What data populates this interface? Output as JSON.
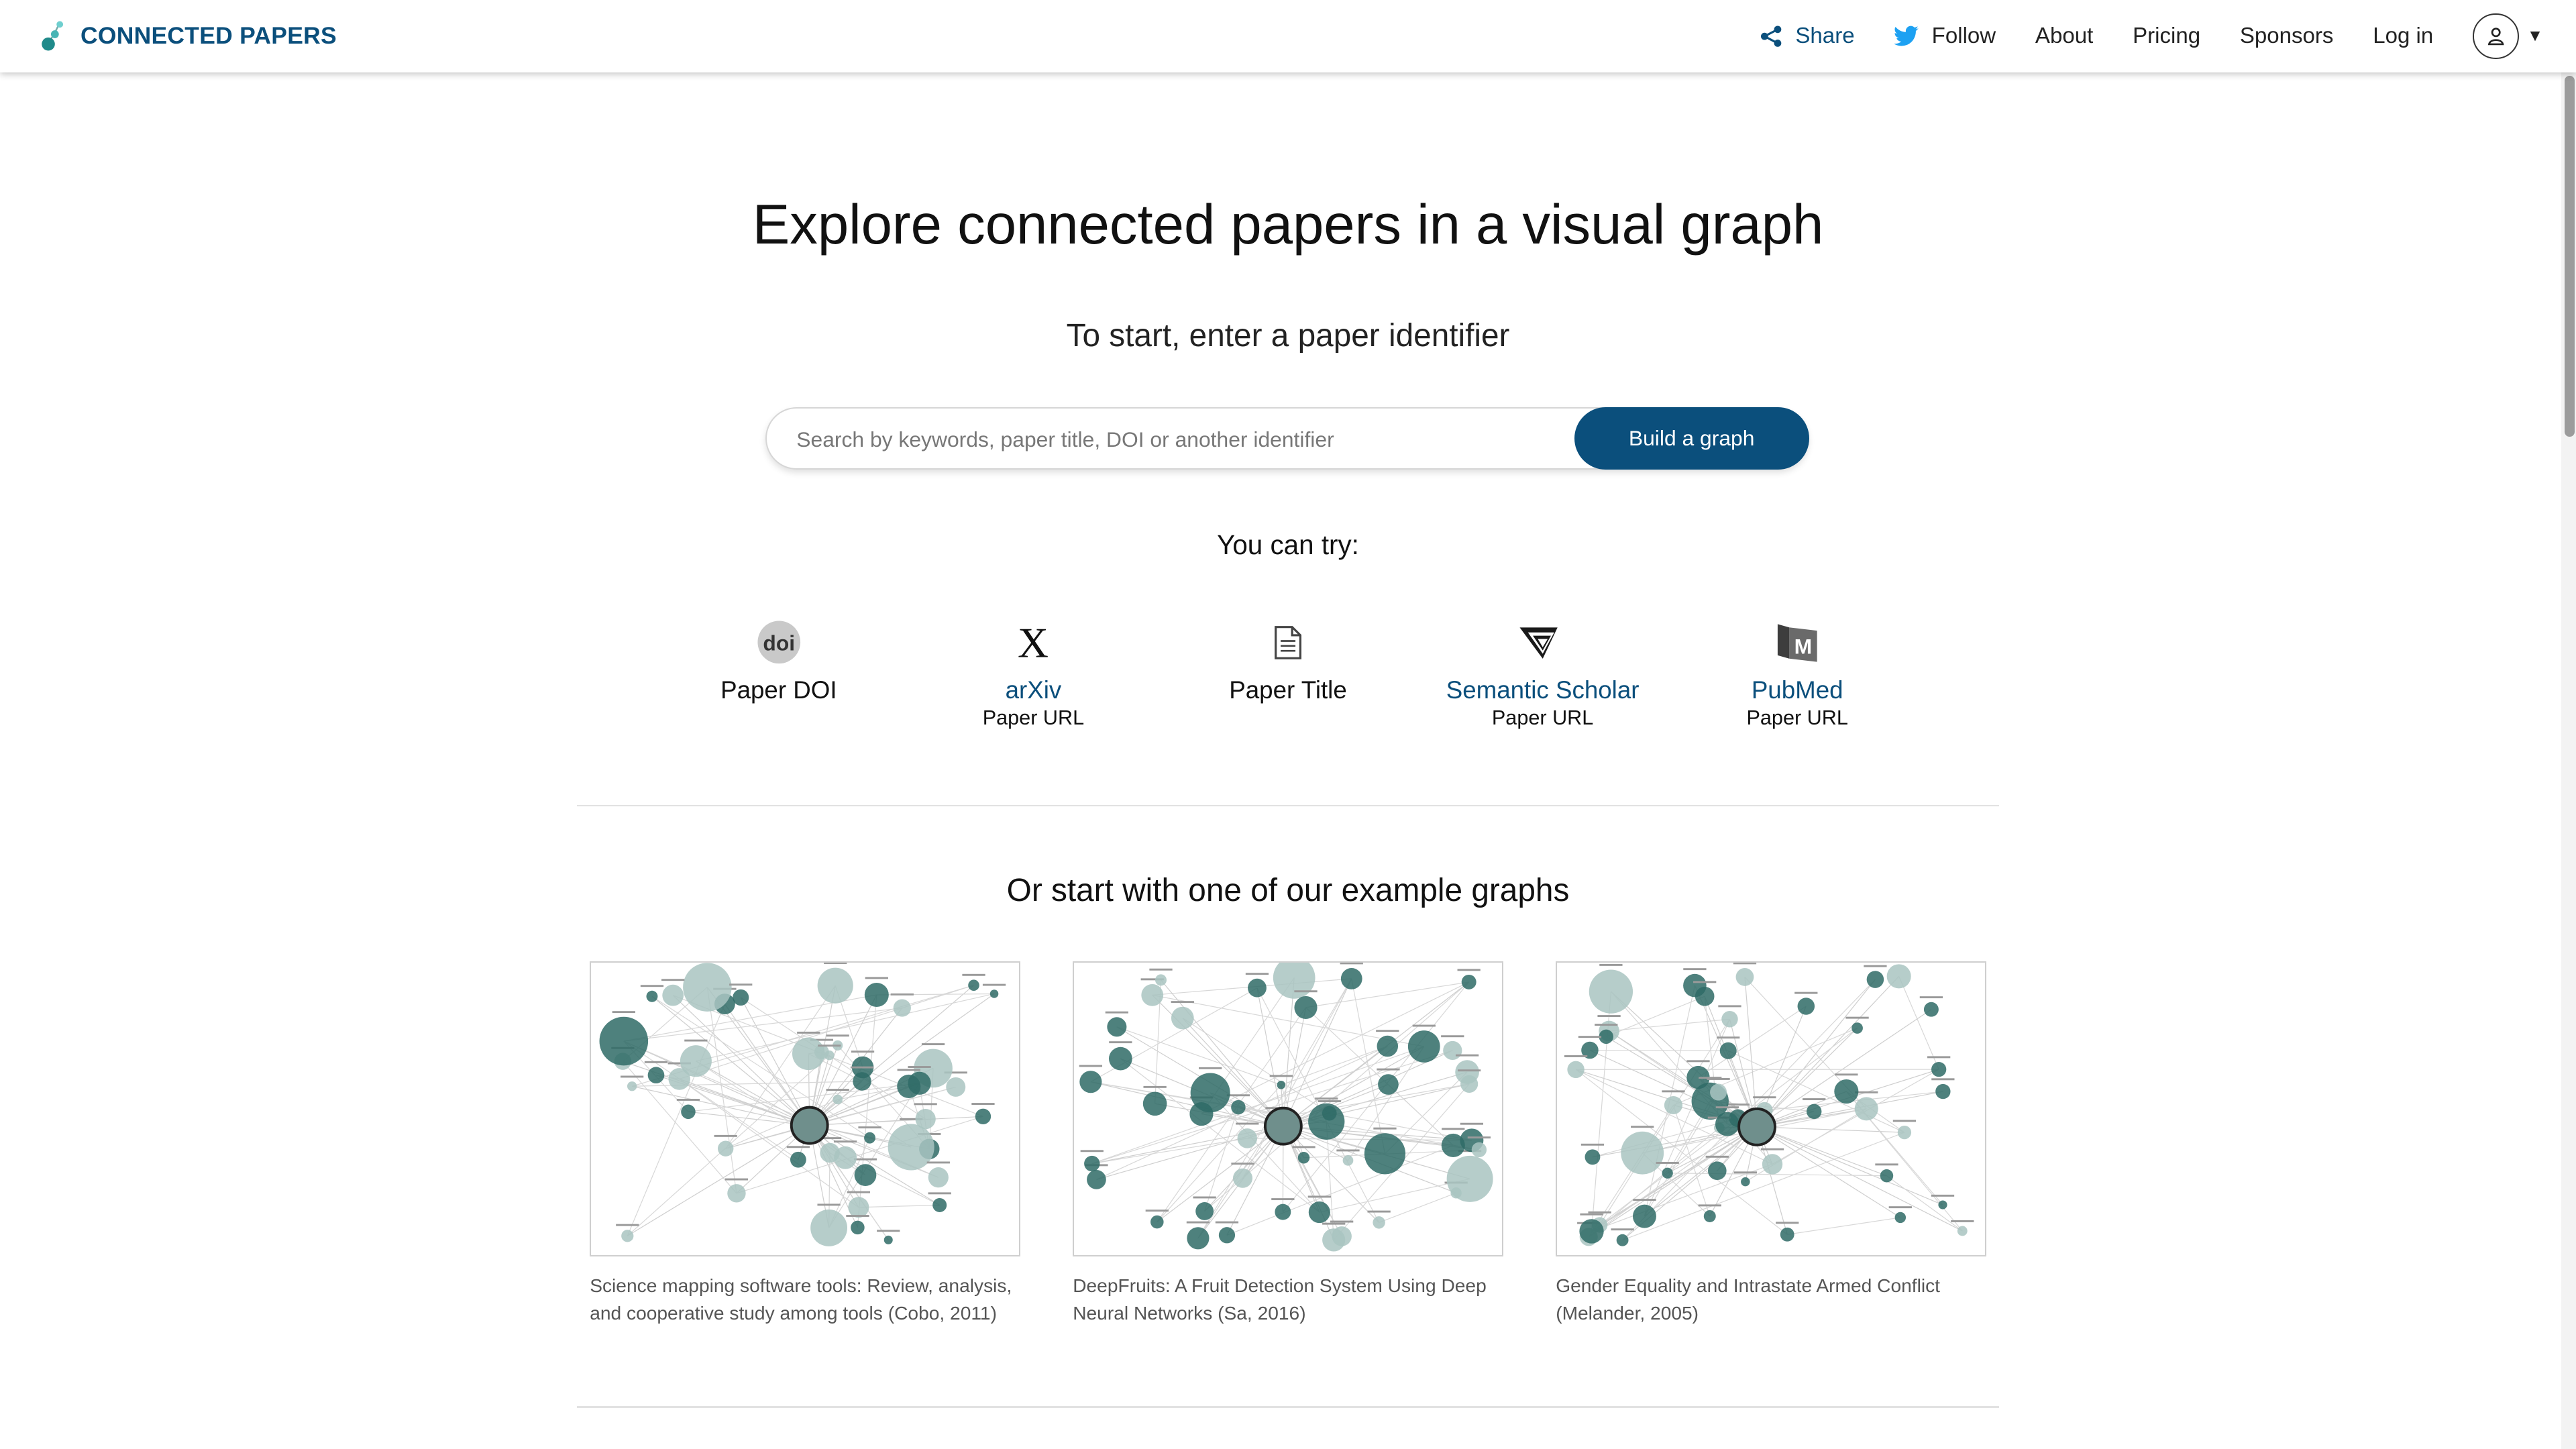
{
  "brand": {
    "name": "CONNECTED PAPERS"
  },
  "nav": {
    "share": "Share",
    "follow": "Follow",
    "about": "About",
    "pricing": "Pricing",
    "sponsors": "Sponsors",
    "login": "Log in"
  },
  "hero": {
    "title": "Explore connected papers in a visual graph",
    "subtitle": "To start, enter a paper identifier"
  },
  "search": {
    "placeholder": "Search by keywords, paper title, DOI or another identifier",
    "value": "",
    "button": "Build a graph"
  },
  "try": {
    "heading": "You can try:",
    "options": [
      {
        "label": "Paper DOI",
        "sub": "",
        "icon": "doi-icon"
      },
      {
        "label": "arXiv",
        "sub": "Paper URL",
        "icon": "arxiv-icon"
      },
      {
        "label": "Paper Title",
        "sub": "",
        "icon": "document-icon"
      },
      {
        "label": "Semantic Scholar",
        "sub": "Paper URL",
        "icon": "semantic-scholar-icon"
      },
      {
        "label": "PubMed",
        "sub": "Paper URL",
        "icon": "pubmed-icon"
      }
    ]
  },
  "examples": {
    "heading": "Or start with one of our example graphs",
    "items": [
      {
        "caption": "Science mapping software tools: Review, analysis, and cooperative study among tools (Cobo, 2011)"
      },
      {
        "caption": "DeepFruits: A Fruit Detection System Using Deep Neural Networks (Sa, 2016)"
      },
      {
        "caption": "Gender Equality and Intrastate Armed Conflict (Melander, 2005)"
      }
    ]
  },
  "colors": {
    "brand": "#0b4f7c",
    "graph_dark": "#2f6b66",
    "graph_light": "#a9c4c1"
  }
}
